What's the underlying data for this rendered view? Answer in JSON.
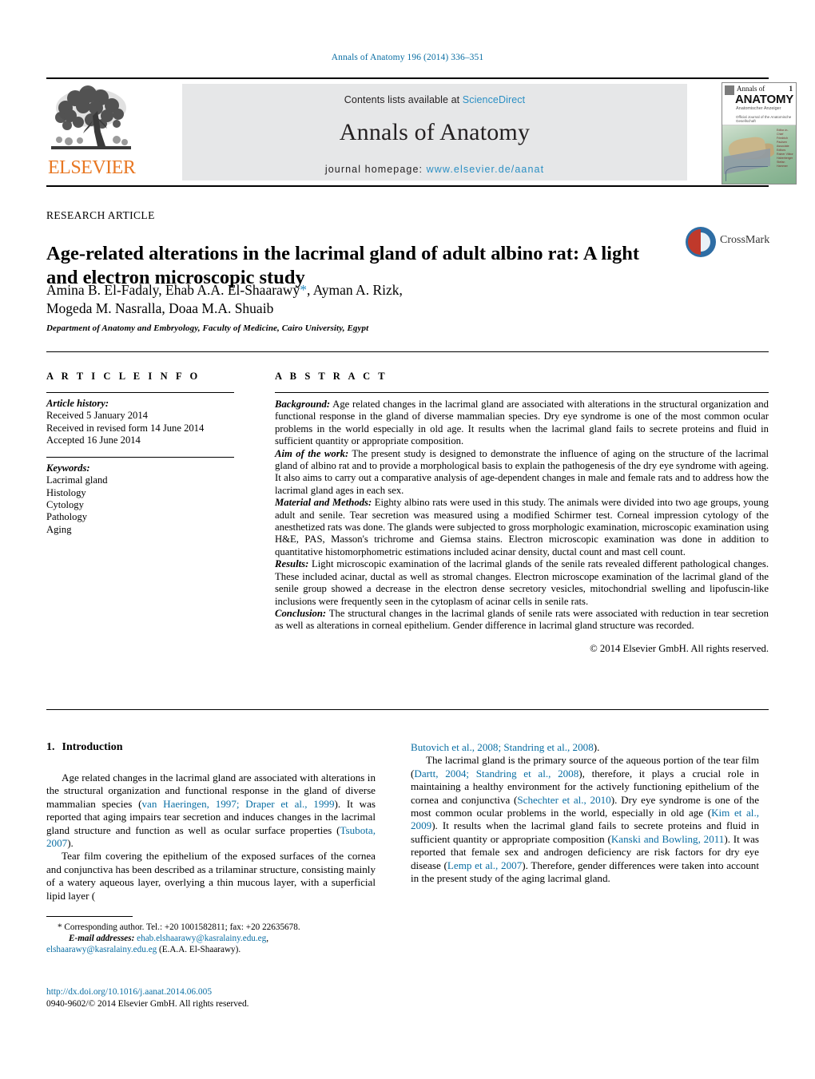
{
  "running_head": "Annals of Anatomy 196 (2014) 336–351",
  "masthead": {
    "contents_prefix": "Contents lists available at ",
    "contents_link": "ScienceDirect",
    "journal_title": "Annals of Anatomy",
    "homepage_prefix": "journal homepage: ",
    "homepage_link": "www.elsevier.de/aanat",
    "publisher": "ELSEVIER",
    "link_color": "#2b8fc4",
    "publisher_color": "#e87722",
    "banner_bg": "#e6e7e8"
  },
  "cover": {
    "line1": "Annals of",
    "volume": "1",
    "line2": "ANATOMY",
    "line3": "Anatomischer Anzeiger",
    "line4": "Official Journal of the Anatomische Gesellschaft",
    "side_text": "Editor-in-Chief Friedrich Paulsen Associate Editors Rainer Viktor Haberberger Stefan Hammer"
  },
  "article": {
    "type": "RESEARCH ARTICLE",
    "title": "Age-related alterations in the lacrimal gland of adult albino rat: A light and electron microscopic study",
    "authors_line1": "Amina B. El-Fadaly, Ehab A.A. El-Shaarawy",
    "authors_line1_tail": ", Ayman A. Rizk,",
    "corresponding_marker": "*",
    "authors_line2": "Mogeda M. Nasralla, Doaa M.A. Shuaib",
    "affiliation": "Department of Anatomy and Embryology, Faculty of Medicine, Cairo University, Egypt",
    "crossmark_label": "CrossMark"
  },
  "info": {
    "heading": "A R T I C L E   I N F O",
    "history_label": "Article history:",
    "history": [
      "Received 5 January 2014",
      "Received in revised form 14 June 2014",
      "Accepted 16 June 2014"
    ],
    "keywords_label": "Keywords:",
    "keywords": [
      "Lacrimal gland",
      "Histology",
      "Cytology",
      "Pathology",
      "Aging"
    ]
  },
  "abstract": {
    "heading": "A B S T R A C T",
    "background_label": "Background:",
    "background": " Age related changes in the lacrimal gland are associated with alterations in the structural organization and functional response in the gland of diverse mammalian species. Dry eye syndrome is one of the most common ocular problems in the world especially in old age. It results when the lacrimal gland fails to secrete proteins and fluid in sufficient quantity or appropriate composition.",
    "aim_label": "Aim of the work:",
    "aim": " The present study is designed to demonstrate the influence of aging on the structure of the lacrimal gland of albino rat and to provide a morphological basis to explain the pathogenesis of the dry eye syndrome with ageing. It also aims to carry out a comparative analysis of age-dependent changes in male and female rats and to address how the lacrimal gland ages in each sex.",
    "methods_label": "Material and Methods:",
    "methods": " Eighty albino rats were used in this study. The animals were divided into two age groups, young adult and senile. Tear secretion was measured using a modified Schirmer test. Corneal impression cytology of the anesthetized rats was done. The glands were subjected to gross morphologic examination, microscopic examination using H&E, PAS, Masson's trichrome and Giemsa stains. Electron microscopic examination was done in addition to quantitative histomorphometric estimations included acinar density, ductal count and mast cell count.",
    "results_label": "Results:",
    "results": " Light microscopic examination of the lacrimal glands of the senile rats revealed different pathological changes. These included acinar, ductal as well as stromal changes. Electron microscope examination of the lacrimal gland of the senile group showed a decrease in the electron dense secretory vesicles, mitochondrial swelling and lipofuscin-like inclusions were frequently seen in the cytoplasm of acinar cells in senile rats.",
    "conclusion_label": "Conclusion:",
    "conclusion": " The structural changes in the lacrimal glands of senile rats were associated with reduction in tear secretion as well as alterations in corneal epithelium. Gender difference in lacrimal gland structure was recorded.",
    "copyright": "© 2014 Elsevier GmbH. All rights reserved."
  },
  "introduction": {
    "number": "1.",
    "heading": "Introduction",
    "p1_a": "Age related changes in the lacrimal gland are associated with alterations in the structural organization and functional response in the gland of diverse mammalian species (",
    "p1_ref1": "van Haeringen, 1997; Draper et al., 1999",
    "p1_b": "). It was reported that aging impairs tear secretion and induces changes in the lacrimal gland structure and function as well as ocular surface properties (",
    "p1_ref2": "Tsubota, 2007",
    "p1_c": ").",
    "p2_a": "Tear film covering the epithelium of the exposed surfaces of the cornea and conjunctiva has been described as a trilaminar structure, consisting mainly of a watery aqueous layer, overlying a thin mucous layer, with a superficial lipid layer (",
    "p2_ref1": "Butovich et al., 2008; Standring et al., 2008",
    "p2_b": ").",
    "p3_a": "The lacrimal gland is the primary source of the aqueous portion of the tear film (",
    "p3_ref1": "Dartt, 2004; Standring et al., 2008",
    "p3_b": "), therefore, it plays a crucial role in maintaining a healthy environment for the actively functioning epithelium of the cornea and conjunctiva (",
    "p3_ref2": "Schechter et al., 2010",
    "p3_c": "). Dry eye syndrome is one of the most common ocular problems in the world, especially in old age (",
    "p3_ref3": "Kim et al., 2009",
    "p3_d": "). It results when the lacrimal gland fails to secrete proteins and fluid in sufficient quantity or appropriate composition (",
    "p3_ref4": "Kanski and Bowling, 2011",
    "p3_e": "). It was reported that female sex and androgen deficiency are risk factors for dry eye disease (",
    "p3_ref5": "Lemp et al., 2007",
    "p3_f": "). Therefore, gender differences were taken into account in the present study of the aging lacrimal gland."
  },
  "footnotes": {
    "corresponding": "* Corresponding author. Tel.: +20 1001582811; fax: +20 22635678.",
    "email_label": "E-mail addresses:",
    "email1": "ehab.elshaarawy@kasralainy.edu.eg",
    "email2": "elshaarawy@kasralainy.edu.eg",
    "email_attrib": " (E.A.A. El-Shaarawy).",
    "doi": "http://dx.doi.org/10.1016/j.aanat.2014.06.005",
    "issn_line": "0940-9602/© 2014 Elsevier GmbH. All rights reserved."
  }
}
